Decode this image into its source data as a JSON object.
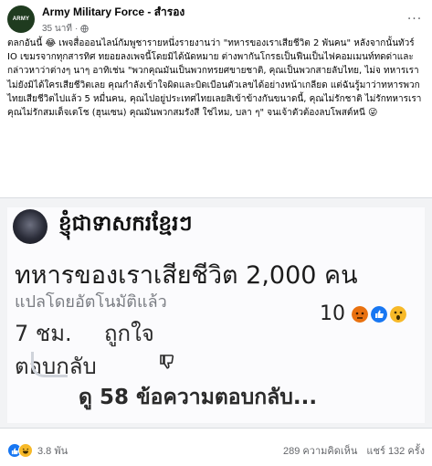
{
  "post": {
    "page_name": "Army Military Force - สำรอง",
    "avatar_text": "ARMY",
    "time": "35 นาที",
    "more_label": "···",
    "caption": "ตลกอันนี้ 😂 เพจสื่อออนไลน์กัมพูชารายหนึ่งรายงานว่า \"ทหารของเราเสียชีวิต 2 พันคน\" หลังจากนั้นทัวร์ IO เขมรจากทุกสารทิศ ทยอยลงเพจนี้โดยมิได้นัดหมาย ต่างพากันโกรธเป็นฟืนเป็นไฟคอมเมนท์ทดด่าและกล่าวหาว่าต่างๆ นาๆ อาทิเช่น \"พวกคุณมันเป็นพวกทรยศขายชาติ, คุณเป็นพวกสายลับไทย, ไม่จ ทหารเราไม่ยังมิได้ใครเสียชีวิตเลย คุณกำลังเข้าใจผิดและบิดเบือนตัวเลขได้อย่างหน้าเกลียด แต่ฉันรู้มาว่าทหารพวกไทยเสียชีวิตไปแล้ว 5 หมื่นคน, คุณไปอยู่ประเทศไทยเลยสิเข้าข้างกันขนาดนี้, คุณไม่รักชาติ ไม่รักทหารเรา คุณไม่รักสมเด็จเตโช (ฮุนเซน) คุณมันพวกสมรังสี ใช่ไหม, บลา ๆ\" จนเจ้าตัวต้องลบโพสต์หนี 😜"
  },
  "screenshot": {
    "commenter_name": "ខ្ញុំជាទាសករខ្មែរៗ",
    "message": "ทหารของเราเสียชีวิต 2,000 คน",
    "translated_note": "แปลโดยอัตโนมัติแล้ว",
    "reaction_count": "10",
    "time": "7 ชม.",
    "like_label": "ถูกใจ",
    "reply_label": "ตอบกลับ",
    "view_replies": "ดู 58 ข้อความตอบกลับ..."
  },
  "footer": {
    "reaction_count": "3.8 พัน",
    "comments": "289 ความคิดเห็น",
    "shares": "แชร์ 132 ครั้ง"
  },
  "colors": {
    "like_blue": "#1877f2",
    "haha_yellow": "#f7b928",
    "angry_red": "#e9710f",
    "meta_gray": "#65676b"
  }
}
